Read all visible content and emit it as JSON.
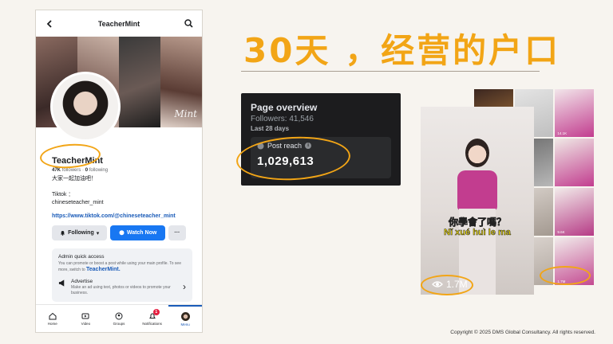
{
  "profile": {
    "app_title": "TeacherMint",
    "name": "TeacherMint",
    "followers_count": "47K",
    "followers_label": "followers",
    "following_count": "0",
    "following_label": "following",
    "bio": "大家一起加油吧！",
    "tiktok_label": "Tiktok ：",
    "tiktok_handle": "chineseteacher_mint",
    "link": "https://www.tiktok.com/@chineseteacher_mint",
    "cover_mark": "Mint",
    "follow_label": "Following",
    "watch_label": "Watch Now",
    "more_label": "···",
    "quick_access": {
      "heading": "Admin quick access",
      "text": "You can promote or boost a post while using your main profile. To see more, switch to",
      "switch_link": "TeacherMint.",
      "advertise_title": "Advertise",
      "advertise_text": "Make an ad using text, photos or videos to promote your business."
    },
    "tabs": [
      {
        "label": "Home",
        "icon": "home-icon"
      },
      {
        "label": "Video",
        "icon": "video-icon"
      },
      {
        "label": "Groups",
        "icon": "groups-icon"
      },
      {
        "label": "Notifications",
        "icon": "bell-icon",
        "badge": "1"
      },
      {
        "label": "Menu",
        "icon": "avatar-icon"
      }
    ]
  },
  "headline": "30天 ，经营的户口",
  "overview": {
    "title": "Page overview",
    "followers": "Followers: 41,546",
    "range": "Last 28 days",
    "reach_label": "Post reach",
    "reach_value": "1,029,613"
  },
  "video": {
    "caption_line1": "你學會了嗎？",
    "caption_line2": "Nǐ xué huì le ma",
    "views": "1.7M"
  },
  "grid_views": [
    "",
    "",
    "14.1K",
    "",
    "",
    "",
    "",
    "",
    "9.6K",
    "",
    "",
    "1.7M"
  ],
  "copyright": "Copyright © 2025  DMS Global Consultancy. All rights reserved.",
  "colors": {
    "accent": "#f2a516",
    "link": "#1a5bb8",
    "primary_button": "#1877f2"
  }
}
